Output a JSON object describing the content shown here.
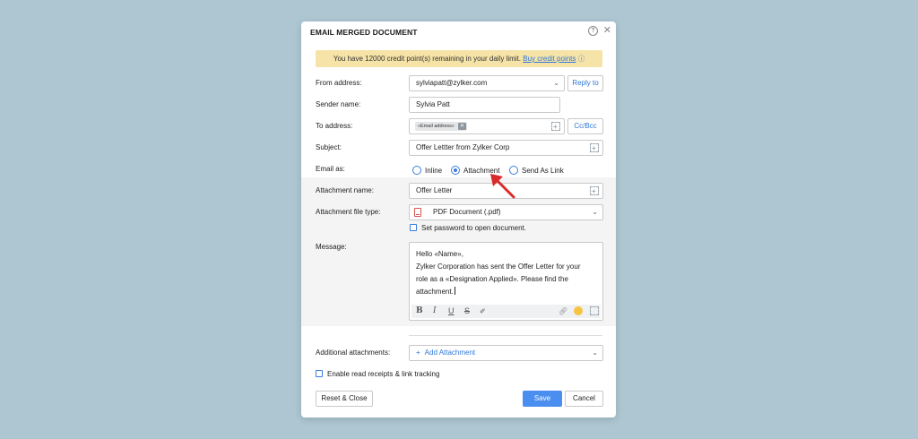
{
  "dialog": {
    "title": "EMAIL MERGED DOCUMENT",
    "help_icon": "question-circle-icon",
    "close_icon": "close-icon"
  },
  "notice": {
    "text": "You have 12000 credit point(s) remaining in your daily limit.",
    "link": "Buy credit points",
    "info": "ⓘ"
  },
  "form": {
    "from": {
      "label": "From address:",
      "value": "sylviapatt@zylker.com",
      "reply_to": "Reply to"
    },
    "sender": {
      "label": "Sender name:",
      "value": "Sylvia Patt"
    },
    "to": {
      "label": "To address:",
      "chip": "«Email address»",
      "cc_bcc": "Cc/Bcc"
    },
    "subject": {
      "label": "Subject:",
      "value": "Offer Lettter from Zylker Corp"
    },
    "email_as": {
      "label": "Email as:",
      "options": [
        "Inline",
        "Attachment",
        "Send As Link"
      ],
      "selected": "Attachment"
    },
    "attachment_name": {
      "label": "Attachment name:",
      "value": "Offer Letter"
    },
    "file_type": {
      "label": "Attachment file type:",
      "value": "PDF Document (.pdf)"
    },
    "password_checkbox": {
      "label": "Set password to open document.",
      "checked": false
    },
    "message": {
      "label": "Message:",
      "lines": [
        "Hello «Name»,",
        "Zylker Corporation has sent the Offer Letter for your",
        "role as a «Designation Applied». Please find the",
        "attachment."
      ],
      "toolbar": {
        "bold": "B",
        "italic": "I",
        "underline": "U",
        "strike": "S"
      }
    },
    "additional": {
      "label": "Additional attachments:",
      "button": "Add Attachment"
    },
    "read_receipts": {
      "label": "Enable read receipts & link tracking",
      "checked": false
    }
  },
  "footer": {
    "reset": "Reset & Close",
    "save": "Save",
    "cancel": "Cancel"
  },
  "colors": {
    "background": "#adc6d1",
    "accent": "#4a8ff0",
    "notice_bg": "#f6e3a7",
    "arrow": "#d92b2b"
  }
}
